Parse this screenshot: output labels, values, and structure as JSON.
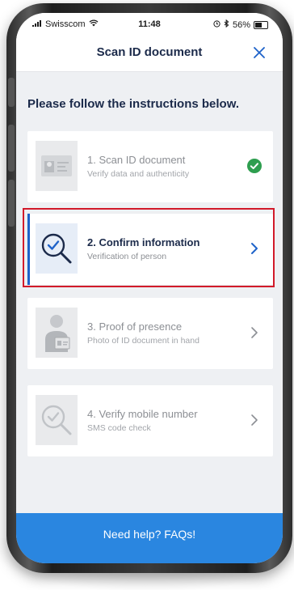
{
  "status_bar": {
    "carrier": "Swisscom",
    "time": "11:48",
    "battery": "56%"
  },
  "header": {
    "title": "Scan ID document",
    "close_icon": "close-icon"
  },
  "instructions": "Please follow the instructions below.",
  "steps": [
    {
      "title": "1. Scan ID document",
      "subtitle": "Verify data and authenticity",
      "status": "completed",
      "icon": "id-card-icon"
    },
    {
      "title": "2. Confirm information",
      "subtitle": "Verification of person",
      "status": "active",
      "icon": "magnifier-check-icon"
    },
    {
      "title": "3. Proof of presence",
      "subtitle": "Photo of ID document in hand",
      "status": "pending",
      "icon": "person-holding-id-icon"
    },
    {
      "title": "4. Verify mobile number",
      "subtitle": "SMS code check",
      "status": "pending",
      "icon": "magnifier-check-icon"
    }
  ],
  "help": {
    "label": "Need help? FAQs!"
  },
  "colors": {
    "accent_blue": "#1e62c9",
    "help_bar": "#2a86e0",
    "success_green": "#2e9e4f",
    "highlight_red": "#d21a2a",
    "title_navy": "#1b2a4a"
  }
}
